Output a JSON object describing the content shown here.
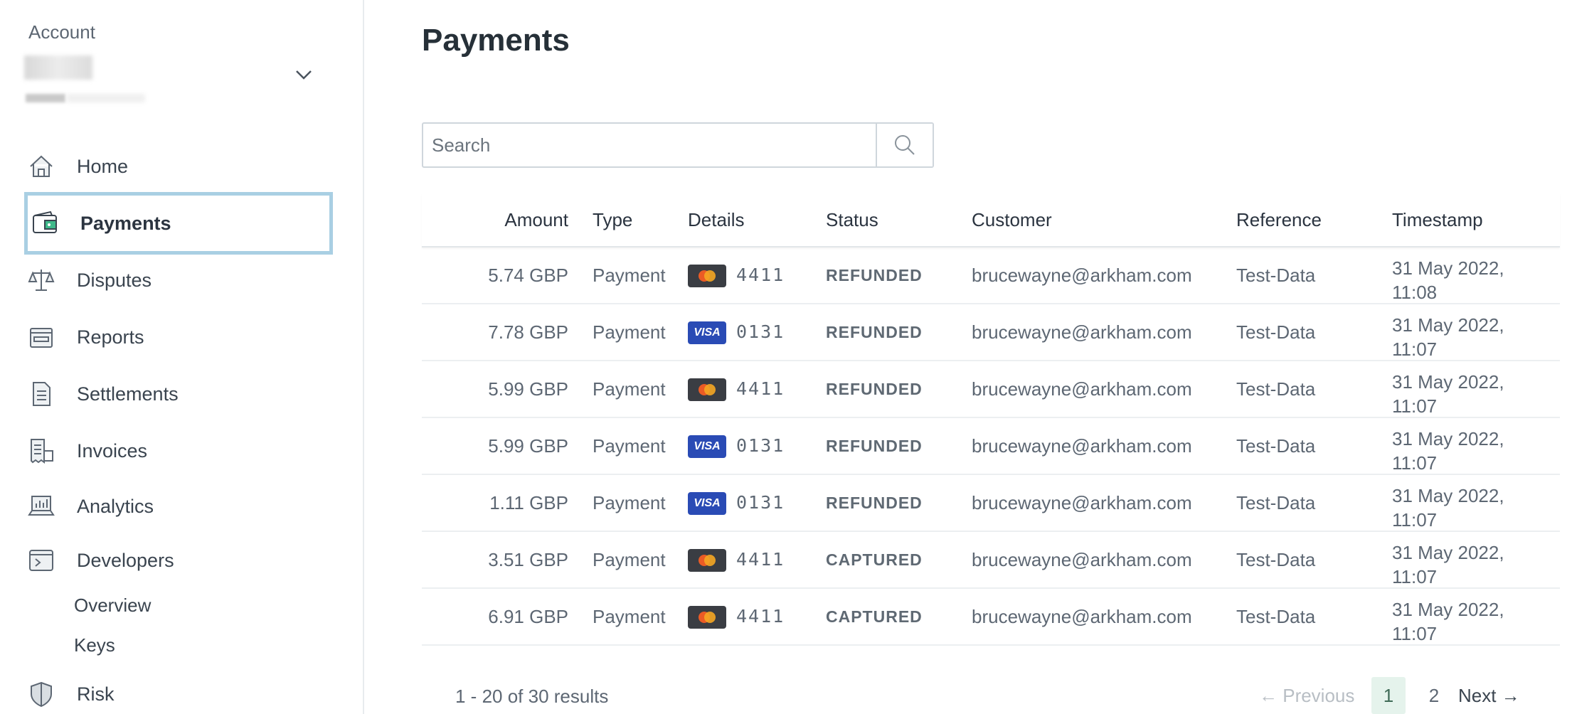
{
  "sidebar": {
    "account_label": "Account",
    "nav": [
      {
        "label": "Home",
        "icon": "home-icon"
      },
      {
        "label": "Payments",
        "icon": "wallet-icon",
        "active": true
      },
      {
        "label": "Disputes",
        "icon": "scales-icon"
      },
      {
        "label": "Reports",
        "icon": "inbox-icon"
      },
      {
        "label": "Settlements",
        "icon": "document-icon"
      },
      {
        "label": "Invoices",
        "icon": "receipt-icon"
      },
      {
        "label": "Analytics",
        "icon": "laptop-chart-icon"
      },
      {
        "label": "Developers",
        "icon": "terminal-icon"
      }
    ],
    "dev_sub": [
      {
        "label": "Overview"
      },
      {
        "label": "Keys"
      }
    ],
    "risk": {
      "label": "Risk",
      "icon": "shield-icon"
    }
  },
  "main": {
    "title": "Payments",
    "search": {
      "placeholder": "Search",
      "value": ""
    },
    "columns": [
      "Amount",
      "Type",
      "Details",
      "Status",
      "Customer",
      "Reference",
      "Timestamp"
    ],
    "rows": [
      {
        "amount": "5.74 GBP",
        "type": "Payment",
        "card": "mastercard",
        "last4": "4411",
        "status": "REFUNDED",
        "customer": "brucewayne@arkham.com",
        "reference": "Test-Data",
        "date": "31 May 2022,",
        "time": "11:08"
      },
      {
        "amount": "7.78 GBP",
        "type": "Payment",
        "card": "visa",
        "card_label": "VISA",
        "last4": "0131",
        "status": "REFUNDED",
        "customer": "brucewayne@arkham.com",
        "reference": "Test-Data",
        "date": "31 May 2022,",
        "time": "11:07"
      },
      {
        "amount": "5.99 GBP",
        "type": "Payment",
        "card": "mastercard",
        "last4": "4411",
        "status": "REFUNDED",
        "customer": "brucewayne@arkham.com",
        "reference": "Test-Data",
        "date": "31 May 2022,",
        "time": "11:07"
      },
      {
        "amount": "5.99 GBP",
        "type": "Payment",
        "card": "visa",
        "card_label": "VISA",
        "last4": "0131",
        "status": "REFUNDED",
        "customer": "brucewayne@arkham.com",
        "reference": "Test-Data",
        "date": "31 May 2022,",
        "time": "11:07"
      },
      {
        "amount": "1.11 GBP",
        "type": "Payment",
        "card": "visa",
        "card_label": "VISA",
        "last4": "0131",
        "status": "REFUNDED",
        "customer": "brucewayne@arkham.com",
        "reference": "Test-Data",
        "date": "31 May 2022,",
        "time": "11:07"
      },
      {
        "amount": "3.51 GBP",
        "type": "Payment",
        "card": "mastercard",
        "last4": "4411",
        "status": "CAPTURED",
        "customer": "brucewayne@arkham.com",
        "reference": "Test-Data",
        "date": "31 May 2022,",
        "time": "11:07"
      },
      {
        "amount": "6.91 GBP",
        "type": "Payment",
        "card": "mastercard",
        "last4": "4411",
        "status": "CAPTURED",
        "customer": "brucewayne@arkham.com",
        "reference": "Test-Data",
        "date": "31 May 2022,",
        "time": "11:07"
      }
    ],
    "results_text": "1 - 20 of 30 results",
    "pager": {
      "prev": "← Previous",
      "page1": "1",
      "page2": "2",
      "next": "Next →"
    }
  },
  "colors": {
    "accent": "#a9cfe3",
    "active_page_bg": "#e5f3ec",
    "visa": "#2a4bb5",
    "mastercard": "#3a3d43"
  }
}
